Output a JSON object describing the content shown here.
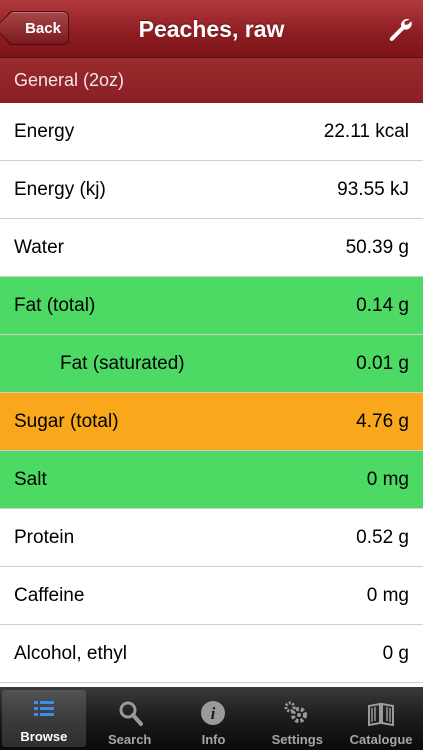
{
  "navbar": {
    "back_label": "Back",
    "title": "Peaches, raw",
    "settings_icon": "wrench-icon"
  },
  "section": {
    "label": "General (2oz)"
  },
  "colors": {
    "navbar": "#8f1e22",
    "green": "#4cd964",
    "orange": "#f9a81c"
  },
  "nutrients": [
    {
      "label": "Energy",
      "value": "22.11 kcal",
      "color": "#ffffff",
      "indent": false
    },
    {
      "label": "Energy (kj)",
      "value": "93.55 kJ",
      "color": "#ffffff",
      "indent": false
    },
    {
      "label": "Water",
      "value": "50.39 g",
      "color": "#ffffff",
      "indent": false
    },
    {
      "label": "Fat (total)",
      "value": "0.14 g",
      "color": "#4cd964",
      "indent": false
    },
    {
      "label": "Fat (saturated)",
      "value": "0.01 g",
      "color": "#4cd964",
      "indent": true
    },
    {
      "label": "Sugar (total)",
      "value": "4.76 g",
      "color": "#f9a81c",
      "indent": false
    },
    {
      "label": "Salt",
      "value": "0 mg",
      "color": "#4cd964",
      "indent": false
    },
    {
      "label": "Protein",
      "value": "0.52 g",
      "color": "#ffffff",
      "indent": false
    },
    {
      "label": "Caffeine",
      "value": "0 mg",
      "color": "#ffffff",
      "indent": false
    },
    {
      "label": "Alcohol, ethyl",
      "value": "0 g",
      "color": "#ffffff",
      "indent": false
    }
  ],
  "tabs": [
    {
      "label": "Browse",
      "icon": "list-icon",
      "selected": true
    },
    {
      "label": "Search",
      "icon": "search-icon",
      "selected": false
    },
    {
      "label": "Info",
      "icon": "info-icon",
      "selected": false
    },
    {
      "label": "Settings",
      "icon": "gears-icon",
      "selected": false
    },
    {
      "label": "Catalogue",
      "icon": "book-icon",
      "selected": false
    }
  ]
}
